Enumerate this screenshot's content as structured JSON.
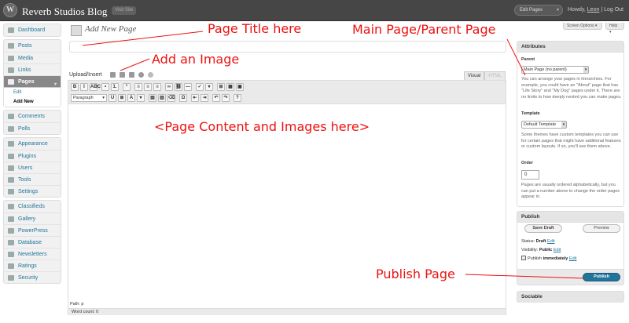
{
  "adminbar": {
    "logo": "W",
    "site_title": "Reverb Studios Blog",
    "visit_site": "Visit Site",
    "favorites": "Edit Pages",
    "favorites_arrow": "▾",
    "howdy": "Howdy,",
    "user": "Leon",
    "separator": "|",
    "logout": "Log Out"
  },
  "sidebar": {
    "groups": [
      [
        {
          "label": "Dashboard"
        }
      ],
      [
        {
          "label": "Posts"
        },
        {
          "label": "Media"
        },
        {
          "label": "Links"
        },
        {
          "label": "Pages",
          "current": true
        }
      ],
      [
        {
          "label": "Comments"
        },
        {
          "label": "Polls"
        }
      ],
      [
        {
          "label": "Appearance"
        },
        {
          "label": "Plugins"
        },
        {
          "label": "Users"
        },
        {
          "label": "Tools"
        },
        {
          "label": "Settings"
        }
      ],
      [
        {
          "label": "Classifieds"
        },
        {
          "label": "Gallery"
        },
        {
          "label": "PowerPress"
        },
        {
          "label": "Database"
        },
        {
          "label": "Newsletters"
        },
        {
          "label": "Ratings"
        },
        {
          "label": "Security"
        }
      ]
    ],
    "pages_sub": [
      "Edit",
      "Add New"
    ],
    "current_arrow": "▾"
  },
  "header": {
    "title": "Add New Page",
    "screen_options": "Screen Options ▾",
    "help": "Help ▾"
  },
  "editor": {
    "upload_label": "Upload/Insert",
    "tab_visual": "Visual",
    "tab_html": "HTML",
    "format_select": "Paragraph",
    "format_arrow": "▾",
    "path_label": "Path: p",
    "word_count_label": "Word count: 0",
    "toolbar_row1": [
      "B",
      "I",
      "ABC",
      "•",
      "1.",
      "“",
      "≡",
      "≡",
      "≡",
      "∞",
      "⛓",
      "—",
      "✓",
      "▾",
      "⊞",
      "▦",
      "▣"
    ],
    "toolbar_row2": [
      "U",
      "≣",
      "A",
      "▾",
      "▤",
      "▥",
      "⌫",
      "Ω",
      "⇤",
      "⇥",
      "↶",
      "↷",
      "?"
    ]
  },
  "attributes": {
    "heading": "Attributes",
    "parent_label": "Parent",
    "parent_value": "Main Page (no parent)",
    "parent_help": "You can arrange your pages in hierarchies. For example, you could have an \"About\" page that has \"Life Story\" and \"My Dog\" pages under it. There are no limits to how deeply nested you can make pages.",
    "template_label": "Template",
    "template_value": "Default Template",
    "template_help": "Some themes have custom templates you can use for certain pages that might have additional features or custom layouts. If so, you'll see them above.",
    "order_label": "Order",
    "order_value": "0",
    "order_help": "Pages are usually ordered alphabetically, but you can put a number above to change the order pages appear in.",
    "arrow": "▾"
  },
  "publish": {
    "heading": "Publish",
    "save_draft": "Save Draft",
    "preview": "Preview",
    "status_label": "Status:",
    "status_value": "Draft",
    "visibility_label": "Visibility:",
    "visibility_value": "Public",
    "publish_label": "Publish",
    "publish_value": "immediately",
    "edit": "Edit",
    "publish_button": "Publish"
  },
  "sociable": {
    "heading": "Sociable"
  },
  "annotations": {
    "page_title": "Page Title here",
    "add_image": "Add an Image",
    "parent_page": "Main Page/Parent Page",
    "content": "<Page Content and Images here>",
    "publish": "Publish Page",
    "color": "#e11111"
  }
}
